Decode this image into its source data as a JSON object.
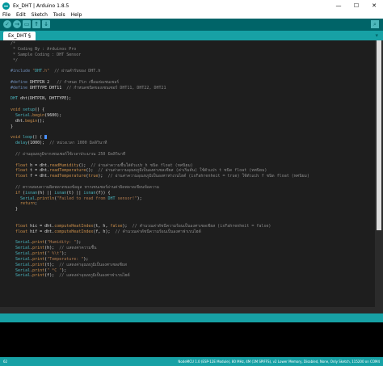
{
  "window": {
    "title": "Ex_DHT | Arduino 1.8.5",
    "controls": [
      "—",
      "☐",
      "✕"
    ]
  },
  "menu": [
    "File",
    "Edit",
    "Sketch",
    "Tools",
    "Help"
  ],
  "toolbar": {
    "buttons": [
      "verify-icon",
      "upload-icon",
      "new-icon",
      "open-icon",
      "save-icon"
    ],
    "glyphs": [
      "✓",
      "→",
      "▭",
      "↑",
      "↓"
    ],
    "serial_glyph": "⌕"
  },
  "tab": {
    "label": "Ex_DHT §",
    "menu_glyph": "▾"
  },
  "code_lines": [
    "/*",
    " * Coding By : Arduinos Pro",
    " * Sample Coding : DHT Sensor",
    " */",
    "",
    "#include \"DHT.h\"  // ผ่านคำรับของ DHT.h",
    "",
    "#define DHTPIN 2   // กำหนด Pin เชื่อมต่อเซนเซอร์",
    "#define DHTTYPE DHT11  // กำหนดชนิดของเซนเซอร์ DHT11, DHT22, DHT21",
    "",
    "DHT dht(DHTPIN, DHTTYPE);",
    "",
    "void setup() {",
    "  Serial.begin(9600);",
    "  dht.begin();",
    "}",
    "",
    "void loop() {",
    "  delay(1000);  // หน่วงเวลา 1000 มิลลิวินาที",
    "",
    "  // อ่านอุณหภูมิจากเซนเซอร์ใช้เวลาประมาณ 250 มิลลิวินาที",
    "",
    "  float h = dht.readHumidity();  // อ่านค่าความชื้นใส่ตัวแปร h ชนิด float (ทศนิยม)",
    "  float t = dht.readTemperature();  // อ่านค่าความอุณหภูมิเป็นองศาเซลเซียส (ค่าเริ่มต้น) ใช้ตัวแปร t ชนิด float (ทศนิยม)",
    "  float f = dht.readTemperature(true);  // อ่านค่าความอุณหภูมิเป็นองศาฟาเรนไฮต์ (isFahrenheit = true) ใช้ตัวแปร f ชนิด float (ทศนิยม)",
    "",
    "  // ตรวจสอบความผิดพลาดของข้อมูล หากเซนเซอร์อ่านค่าผิดพลาดเขียนข้อความ",
    "  if (isnan(h) || isnan(t) || isnan(f)) {",
    "    Serial.println(\"Failed to read from DHT sensor!\");",
    "    return;",
    "  }",
    "",
    "",
    "  float hic = dht.computeHeatIndex(t, h, false);  // คำนวณค่าดัชนีความร้อนเป็นองศาเซลเซียส (isFahrenheit = false)",
    "  float hif = dht.computeHeatIndex(f, h);  // คำนวณค่าดัชนีความร้อนเป็นองศาฟาเรนไฮต์",
    "",
    "  Serial.print(\"Humidity: \");",
    "  Serial.print(h);  // แสดงค่าความชื้น",
    "  Serial.print(\" %\\t\");",
    "  Serial.print(\"Temperature: \");",
    "  Serial.print(t);  // แสดงค่าอุณหภูมิเป็นองศาเซลเซียส",
    "  Serial.print(\" *C \");",
    "  Serial.print(f);  // แสดงค่าอุณหภูมิเป็นองศาฟาเรนไฮต์"
  ],
  "status_text": "",
  "footer": {
    "line_number": "62",
    "board_info": "NodeMCU 1.0 (ESP-12E Module), 80 MHz, 4M (1M SPIFFS), v2 Lower Memory, Disabled, None, Only Sketch, 115200 on COM4"
  },
  "colors": {
    "teal": "#17a1a5",
    "dark_teal": "#006468",
    "editor_bg": "#1e1e1e",
    "keyword": "#cc8f4a",
    "function": "#cc8f4a",
    "type": "#4ab5bf",
    "comment": "#8b8b8b",
    "string": "#b07a4e",
    "preproc": "#6e8bb5"
  }
}
